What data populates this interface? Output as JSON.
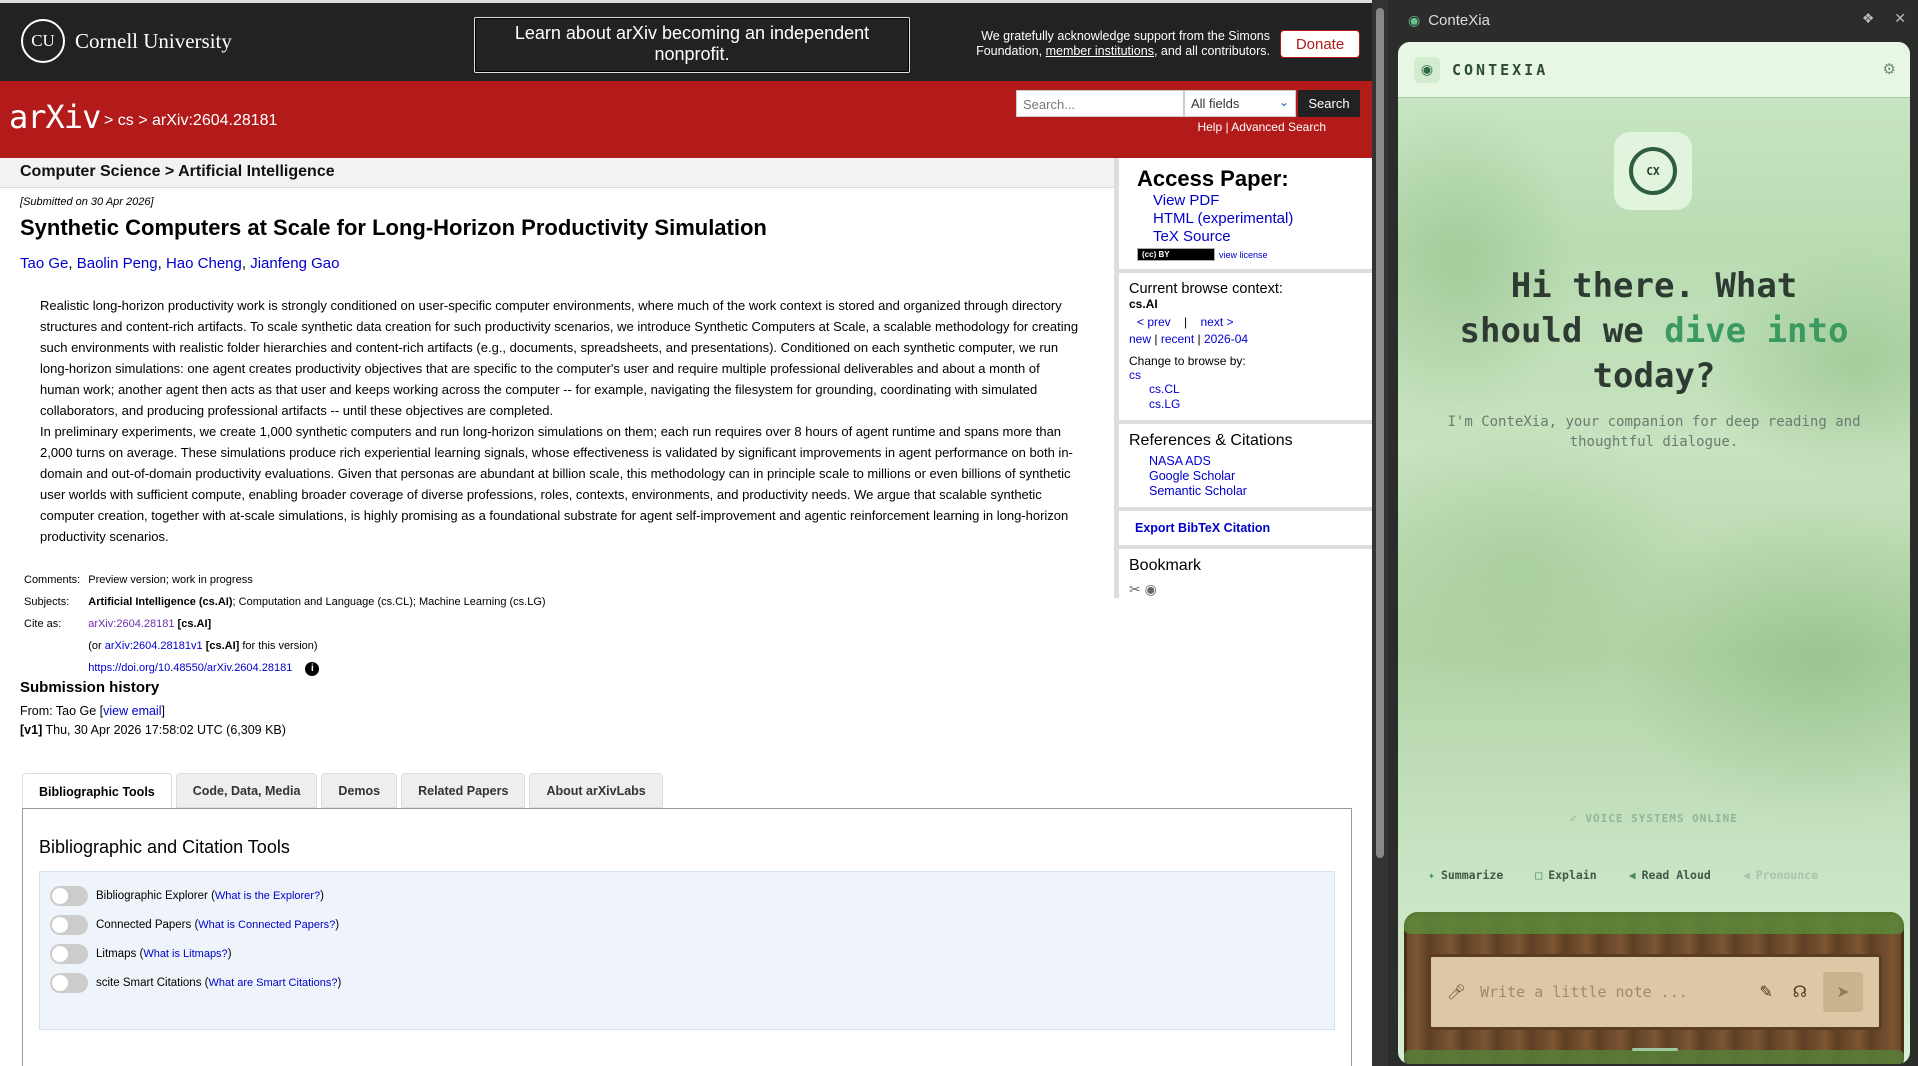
{
  "top": {
    "cornell_seal": "CU",
    "cornell": "Cornell University",
    "announcement": "Learn about arXiv becoming an independent nonprofit.",
    "ack_prefix": "We gratefully acknowledge support from the Simons Foundation,",
    "ack_link": "member institutions",
    "ack_suffix": ", and all contributors.",
    "donate": "Donate"
  },
  "header": {
    "logo": "arXiv",
    "breadcrumb": "> cs > arXiv:2604.28181",
    "search_placeholder": "Search...",
    "fields_selected": "All fields",
    "search_button": "Search",
    "help": "Help",
    "separator": "|",
    "advanced": "Advanced Search"
  },
  "subject_bar": "Computer Science > Artificial Intelligence",
  "paper": {
    "submitted": "[Submitted on 30 Apr 2026]",
    "title": "Synthetic Computers at Scale for Long-Horizon Productivity Simulation",
    "authors": [
      "Tao Ge",
      "Baolin Peng",
      "Hao Cheng",
      "Jianfeng Gao"
    ],
    "abstract_p1": "Realistic long-horizon productivity work is strongly conditioned on user-specific computer environments, where much of the work context is stored and organized through directory structures and content-rich artifacts. To scale synthetic data creation for such productivity scenarios, we introduce Synthetic Computers at Scale, a scalable methodology for creating such environments with realistic folder hierarchies and content-rich artifacts (e.g., documents, spreadsheets, and presentations). Conditioned on each synthetic computer, we run long-horizon simulations: one agent creates productivity objectives that are specific to the computer's user and require multiple professional deliverables and about a month of human work; another agent then acts as that user and keeps working across the computer -- for example, navigating the filesystem for grounding, coordinating with simulated collaborators, and producing professional artifacts -- until these objectives are completed.",
    "abstract_p2": "In preliminary experiments, we create 1,000 synthetic computers and run long-horizon simulations on them; each run requires over 8 hours of agent runtime and spans more than 2,000 turns on average. These simulations produce rich experiential learning signals, whose effectiveness is validated by significant improvements in agent performance on both in-domain and out-of-domain productivity evaluations. Given that personas are abundant at billion scale, this methodology can in principle scale to millions or even billions of synthetic user worlds with sufficient compute, enabling broader coverage of diverse professions, roles, contexts, environments, and productivity needs. We argue that scalable synthetic computer creation, together with at-scale simulations, is highly promising as a foundational substrate for agent self-improvement and agentic reinforcement learning in long-horizon productivity scenarios.",
    "comments_label": "Comments:",
    "comments": "Preview version; work in progress",
    "subjects_label": "Subjects:",
    "subjects_primary": "Artificial Intelligence (cs.AI)",
    "subjects_rest": "; Computation and Language (cs.CL); Machine Learning (cs.LG)",
    "cite_label": "Cite as:",
    "cite_id": "arXiv:2604.28181",
    "cite_tag": "[cs.AI]",
    "cite_or": "(or",
    "cite_v1": "arXiv:2604.28181v1",
    "cite_v1_tag": "[cs.AI]",
    "cite_v1_suffix": "for this version)",
    "doi": "https://doi.org/10.48550/arXiv.2604.28181",
    "info_glyph": "i",
    "history_heading": "Submission history",
    "from_prefix": "From: Tao Ge [",
    "view_email": "view email",
    "from_suffix": "]",
    "v1_label": "[v1]",
    "v1_text": "Thu, 30 Apr 2026 17:58:02 UTC (6,309 KB)"
  },
  "tabs": [
    "Bibliographic Tools",
    "Code, Data, Media",
    "Demos",
    "Related Papers",
    "About arXivLabs"
  ],
  "tool_panel": {
    "heading": "Bibliographic and Citation Tools",
    "rows": [
      {
        "label": "Bibliographic Explorer",
        "link": "What is the Explorer?"
      },
      {
        "label": "Connected Papers",
        "link": "What is Connected Papers?"
      },
      {
        "label": "Litmaps",
        "link": "What is Litmaps?"
      },
      {
        "label": "scite Smart Citations",
        "link": "What are Smart Citations?"
      }
    ]
  },
  "sidebar": {
    "access_heading": "Access Paper:",
    "access_links": [
      "View PDF",
      "HTML (experimental)",
      "TeX Source"
    ],
    "license_badge": "(cc) BY",
    "license_link": "view license",
    "context_heading": "Current browse context:",
    "context": "cs.AI",
    "prev": "< prev",
    "nav_sep": "|",
    "next": "next >",
    "new": "new",
    "recent": "recent",
    "date": "2026-04",
    "change_label": "Change to browse by:",
    "browse_cs": "cs",
    "browse_sub": [
      "cs.CL",
      "cs.LG"
    ],
    "refs_heading": "References & Citations",
    "refs_links": [
      "NASA ADS",
      "Google Scholar",
      "Semantic Scholar"
    ],
    "bibtex": "Export BibTeX Citation",
    "bookmark_heading": "Bookmark",
    "bookmark_icons": "✂ ◉"
  },
  "contexia": {
    "window_title": "ConteXia",
    "brand": "CONTEXIA",
    "avatar_text": "CX",
    "hero_line1": "Hi there. What",
    "hero_line2a": "should we ",
    "hero_line2b": "dive into",
    "hero_line3": "today?",
    "subtitle": "I'm ConteXia, your companion for deep reading and thoughtful dialogue.",
    "voice_status": "VOICE SYSTEMS ONLINE",
    "actions": [
      "Summarize",
      "Explain",
      "Read Aloud",
      "Pronounce"
    ],
    "input_placeholder": "Write a little note ..."
  }
}
